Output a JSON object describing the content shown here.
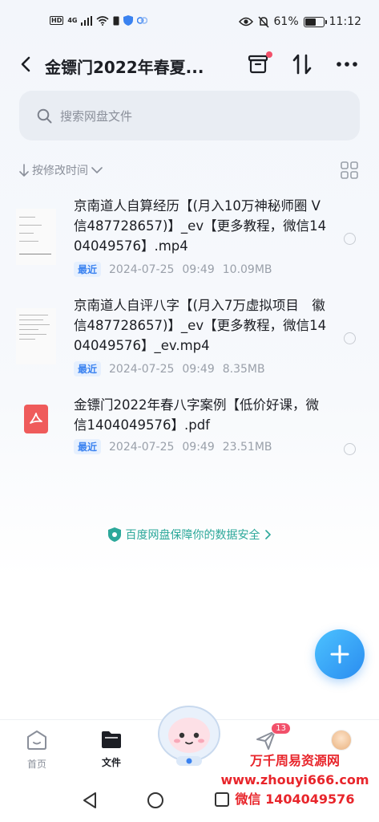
{
  "status_bar": {
    "network_label": "4G",
    "hd_label": "HD",
    "battery_percent": "61%",
    "battery_level": 0.61,
    "time": "11:12"
  },
  "nav": {
    "title": "金镖门2022年春夏..."
  },
  "search": {
    "placeholder": "搜索网盘文件"
  },
  "sort": {
    "label": "按修改时间"
  },
  "files": [
    {
      "name": "京南道人自算经历【(月入10万神秘师圈 V信487728657)】_ev【更多教程，微信1404049576】.mp4",
      "badge": "最近",
      "date": "2024-07-25",
      "time": "09:49",
      "size": "10.09MB",
      "icon": "video-thumbnail"
    },
    {
      "name": "京南道人自评八字【(月入7万虚拟项目　徽信487728657)】_ev【更多教程，微信1404049576】_ev.mp4",
      "badge": "最近",
      "date": "2024-07-25",
      "time": "09:49",
      "size": "8.35MB",
      "icon": "video-thumbnail"
    },
    {
      "name": "金镖门2022年春八字案例【低价好课，微信1404049576】.pdf",
      "badge": "最近",
      "date": "2024-07-25",
      "time": "09:49",
      "size": "23.51MB",
      "icon": "pdf-icon"
    }
  ],
  "security_notice": "百度网盘保障你的数据安全",
  "tabs": [
    {
      "label": "首页"
    },
    {
      "label": "文件"
    },
    {
      "label": ""
    },
    {
      "label": "",
      "badge": "13"
    },
    {
      "label": ""
    }
  ],
  "watermark": {
    "line1": "万千周易资源网",
    "line2": "www.zhouyi666.com",
    "line3": "微信 1404049576"
  },
  "colors": {
    "accent": "#3a82f0",
    "badge_red": "#f2506a",
    "security_green": "#2ca89a",
    "pdf_red": "#ef5b5b"
  }
}
